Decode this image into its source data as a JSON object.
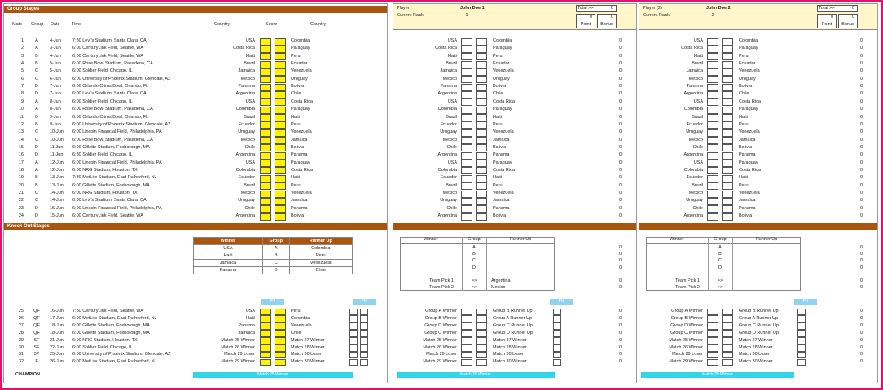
{
  "sections": {
    "group_stages": "Group Stages",
    "knock_out": "Knock Out Stages",
    "champion": "CHAMPION"
  },
  "headers": {
    "match": "Matc",
    "group": "Group",
    "date": "Date",
    "time": "Time",
    "country": "Country",
    "score": "Score"
  },
  "group_matches": [
    {
      "m": "1",
      "g": "A",
      "d": "4-Jun",
      "t": "7:30 Levi's Stadium, Santa Clara, CA",
      "h": "USA",
      "a": "Colombia"
    },
    {
      "m": "2",
      "g": "A",
      "d": "3-Jun",
      "t": "6:00 CenturyLink Field, Seattle, WA",
      "h": "Costa Rica",
      "a": "Paraguay"
    },
    {
      "m": "3",
      "g": "B",
      "d": "4-Jun",
      "t": "6:00 CenturyLink Field, Seattle, WA",
      "h": "Haiti",
      "a": "Peru"
    },
    {
      "m": "4",
      "g": "B",
      "d": "5-Jun",
      "t": "6:00 Rose Bowl Stadium, Pasadena, CA",
      "h": "Brazil",
      "a": "Ecuador"
    },
    {
      "m": "5",
      "g": "C",
      "d": "5-Jun",
      "t": "6:00 Soldier Field, Chicago, IL",
      "h": "Jamaica",
      "a": "Venezuela"
    },
    {
      "m": "6",
      "g": "C",
      "d": "6-Jun",
      "t": "6:00 University of Phoenix Stadium, Glendale, AZ",
      "h": "Mexico",
      "a": "Uruguay"
    },
    {
      "m": "7",
      "g": "D",
      "d": "7-Jun",
      "t": "6:00 Orlando Citrus Bowl, Orlando, FL",
      "h": "Panama",
      "a": "Bolivia"
    },
    {
      "m": "8",
      "g": "D",
      "d": "7-Jun",
      "t": "6:00 Levi's Stadium, Santa Clara, CA",
      "h": "Argentina",
      "a": "Chile"
    },
    {
      "m": "9",
      "g": "A",
      "d": "8-Jun",
      "t": "6:00 Soldier Field, Chicago, IL",
      "h": "USA",
      "a": "Costa Rica"
    },
    {
      "m": "10",
      "g": "A",
      "d": "8-Jun",
      "t": "6:00 Rose Bowl Stadium, Pasadena, CA",
      "h": "Colombia",
      "a": "Paraguay"
    },
    {
      "m": "11",
      "g": "B",
      "d": "9-Jun",
      "t": "6:00 Orlando Citrus Bowl, Orlando, FL",
      "h": "Brazil",
      "a": "Haiti"
    },
    {
      "m": "12",
      "g": "B",
      "d": "9-Jun",
      "t": "6:00 University of Phoenix Stadium, Glendale, AZ",
      "h": "Ecuador",
      "a": "Peru"
    },
    {
      "m": "13",
      "g": "C",
      "d": "10-Jun",
      "t": "6:00 Lincoln Financial Field, Philadelphia, PA",
      "h": "Uruguay",
      "a": "Venezuela"
    },
    {
      "m": "14",
      "g": "C",
      "d": "10-Jun",
      "t": "6:00 Rose Bowl Stadium, Pasadena, CA",
      "h": "Mexico",
      "a": "Jamaica"
    },
    {
      "m": "15",
      "g": "D",
      "d": "11-Jun",
      "t": "6:00 Gillette Stadium, Foxborough, MA",
      "h": "Chile",
      "a": "Bolivia"
    },
    {
      "m": "16",
      "g": "D",
      "d": "11-Jun",
      "t": "6:30 Soldier Field, Chicago, IL",
      "h": "Argentina",
      "a": "Panama"
    },
    {
      "m": "17",
      "g": "A",
      "d": "12-Jun",
      "t": "6:00 Lincoln Financial Field, Philadelphia, PA",
      "h": "USA",
      "a": "Paraguay"
    },
    {
      "m": "18",
      "g": "A",
      "d": "12-Jun",
      "t": "6:00 NRG Stadium, Houston, TX",
      "h": "Colombia",
      "a": "Costa Rica"
    },
    {
      "m": "19",
      "g": "B",
      "d": "13-Jun",
      "t": "7:30 MetLife Stadium, East Rutherford, NJ",
      "h": "Ecuador",
      "a": "Haiti"
    },
    {
      "m": "20",
      "g": "B",
      "d": "13-Jun",
      "t": "6:00 Gillette Stadium, Foxborough, MA",
      "h": "Brazil",
      "a": "Peru"
    },
    {
      "m": "21",
      "g": "C",
      "d": "14-Jun",
      "t": "6:00 NRG Stadium, Houston, TX",
      "h": "Mexico",
      "a": "Venezuela"
    },
    {
      "m": "22",
      "g": "C",
      "d": "14-Jun",
      "t": "6:00 Levi's Stadium, Santa Clara, CA",
      "h": "Uruguay",
      "a": "Jamaica"
    },
    {
      "m": "23",
      "g": "D",
      "d": "15-Jun",
      "t": "6:00 Lincoln Financial Field, Philadelphia, PA",
      "h": "Chile",
      "a": "Panama"
    },
    {
      "m": "24",
      "g": "D",
      "d": "15-Jun",
      "t": "6:00 CenturyLink Field, Seattle, WA",
      "h": "Argentina",
      "a": "Bolivia"
    }
  ],
  "winner_table": {
    "headers": [
      "Winner",
      "Group",
      "Runner Up"
    ],
    "rows": [
      {
        "w": "USA",
        "g": "A",
        "r": "Colombia"
      },
      {
        "w": "Haiti",
        "g": "B",
        "r": "Peru"
      },
      {
        "w": "Jamaica",
        "g": "C",
        "r": "Venezuela"
      },
      {
        "w": "Panama",
        "g": "D",
        "r": "Chile"
      }
    ]
  },
  "ko_labels": {
    "ft": "FT",
    "pk": "PK",
    "final_winner": "Match 25 Winner"
  },
  "ko_matches": [
    {
      "m": "25",
      "g": "QF",
      "d": "16-Jun",
      "t": "7:30 CenturyLink Field, Seattle, WA",
      "h": "USA",
      "a": "Peru"
    },
    {
      "m": "26",
      "g": "QF",
      "d": "17-Jun",
      "t": "6:00 MetLife Stadium, East Rutherford, NJ",
      "h": "Haiti",
      "a": "Colombia"
    },
    {
      "m": "27",
      "g": "QF",
      "d": "18-Jun",
      "t": "6:00 Gillette Stadium, Foxborough, MA",
      "h": "Panama",
      "a": "Venezuela"
    },
    {
      "m": "28",
      "g": "QF",
      "d": "18-Jun",
      "t": "6:00 Gillette Stadium, Foxborough, MA",
      "h": "Jamaica",
      "a": "Chile"
    },
    {
      "m": "29",
      "g": "SF",
      "d": "21-Jun",
      "t": "6:00 NRG Stadium, Houston, TX",
      "h": "Match 25 Winner",
      "a": "Match 27 Winner"
    },
    {
      "m": "30",
      "g": "SF",
      "d": "22-Jun",
      "t": "6:00 Soldier Field, Chicago, IL",
      "h": "Match 26 Winner",
      "a": "Match 28 Winner"
    },
    {
      "m": "31",
      "g": "3P",
      "d": "25-Jun",
      "t": "6:00 University of Phoenix Stadium, Glendale, AZ",
      "h": "Match 29 Loser",
      "a": "Match 30 Loser"
    },
    {
      "m": "32",
      "g": "F",
      "d": "26-Jun",
      "t": "6:00 MetLife Stadium, East Rutherford, NJ",
      "h": "Match 29 Winner",
      "a": "Match 30 Winner"
    }
  ],
  "players": [
    {
      "player_label": "Player",
      "name": "John Doe 1",
      "rank_label": "Current Rank",
      "rank": "1",
      "total_label": "Total >>",
      "total": "0",
      "points_value": "0",
      "bonus_value": "0",
      "point_label": "Point",
      "bonus_label": "Bonus",
      "groups": [
        {
          "h": "USA",
          "a": "Colombia",
          "p": "0"
        },
        {
          "h": "Costa Rica",
          "a": "Paraguay",
          "p": "0"
        },
        {
          "h": "Haiti",
          "a": "Peru",
          "p": "0"
        },
        {
          "h": "Brazil",
          "a": "Ecuador",
          "p": "0"
        },
        {
          "h": "Jamaica",
          "a": "Venezuela",
          "p": "0"
        },
        {
          "h": "Mexico",
          "a": "Uruguay",
          "p": "0"
        },
        {
          "h": "Panama",
          "a": "Bolivia",
          "p": "0"
        },
        {
          "h": "Argentina",
          "a": "Chile",
          "p": "0"
        },
        {
          "h": "USA",
          "a": "Costa Rica",
          "p": "0"
        },
        {
          "h": "Colombia",
          "a": "Paraguay",
          "p": "0"
        },
        {
          "h": "Brazil",
          "a": "Haiti",
          "p": "0"
        },
        {
          "h": "Ecuador",
          "a": "Peru",
          "p": "0"
        },
        {
          "h": "Uruguay",
          "a": "Venezuela",
          "p": "0"
        },
        {
          "h": "Mexico",
          "a": "Jamaica",
          "p": "0"
        },
        {
          "h": "Chile",
          "a": "Bolivia",
          "p": "0"
        },
        {
          "h": "Argentina",
          "a": "Panama",
          "p": "0"
        },
        {
          "h": "USA",
          "a": "Paraguay",
          "p": "0"
        },
        {
          "h": "Colombia",
          "a": "Costa Rica",
          "p": "0"
        },
        {
          "h": "Ecuador",
          "a": "Haiti",
          "p": "0"
        },
        {
          "h": "Brazil",
          "a": "Peru",
          "p": "0"
        },
        {
          "h": "Mexico",
          "a": "Venezuela",
          "p": "0"
        },
        {
          "h": "Uruguay",
          "a": "Jamaica",
          "p": "0"
        },
        {
          "h": "Chile",
          "a": "Panama",
          "p": "0"
        },
        {
          "h": "Argentina",
          "a": "Bolivia",
          "p": "0"
        }
      ],
      "winner_rows": [
        {
          "w": "",
          "g": "A",
          "r": "",
          "p": "0"
        },
        {
          "w": "",
          "g": "B",
          "r": "",
          "p": "0"
        },
        {
          "w": "",
          "g": "C",
          "r": "",
          "p": "0"
        },
        {
          "w": "",
          "g": "D",
          "r": "",
          "p": "0"
        }
      ],
      "team_picks": [
        {
          "label": "Team Pick 1",
          "arrow": ">>",
          "team": "Argentina",
          "p": "0"
        },
        {
          "label": "Team Pick 2",
          "arrow": ">>",
          "team": "Mexico",
          "p": "0"
        }
      ],
      "ko": [
        {
          "h": "Group A Winner",
          "a": "Group B Runner Up",
          "p": "0"
        },
        {
          "h": "Group B Winner",
          "a": "Group A Runner Up",
          "p": "0"
        },
        {
          "h": "Group D Winner",
          "a": "Group C Runner Up",
          "p": "0"
        },
        {
          "h": "Group C Winner",
          "a": "Group D Runner Up",
          "p": "0"
        },
        {
          "h": "Match 25 Winner",
          "a": "Match 27 Winner",
          "p": "0"
        },
        {
          "h": "Match 26 Winner",
          "a": "Match 28 Winner",
          "p": "0"
        },
        {
          "h": "Match 29 Loser",
          "a": "Match 30 Loser",
          "p": "0"
        },
        {
          "h": "Match 29 Winner",
          "a": "Match 30 Winner",
          "p": "0"
        }
      ]
    },
    {
      "player_label": "Player (2)",
      "name": "John Doe 2",
      "rank_label": "Current Rank",
      "rank": "2",
      "total_label": "Total >>",
      "total": "0",
      "points_value": "0",
      "bonus_value": "0",
      "point_label": "Point",
      "bonus_label": "Bonus",
      "groups": [
        {
          "h": "USA",
          "a": "Colombia",
          "p": "0"
        },
        {
          "h": "Costa Rica",
          "a": "Paraguay",
          "p": "0"
        },
        {
          "h": "Haiti",
          "a": "Peru",
          "p": "0"
        },
        {
          "h": "Brazil",
          "a": "Ecuador",
          "p": "0"
        },
        {
          "h": "Jamaica",
          "a": "Venezuela",
          "p": "0"
        },
        {
          "h": "Mexico",
          "a": "Uruguay",
          "p": "0"
        },
        {
          "h": "Panama",
          "a": "Bolivia",
          "p": "0"
        },
        {
          "h": "Argentina",
          "a": "Chile",
          "p": "0"
        },
        {
          "h": "USA",
          "a": "Costa Rica",
          "p": "0"
        },
        {
          "h": "Colombia",
          "a": "Paraguay",
          "p": "0"
        },
        {
          "h": "Brazil",
          "a": "Haiti",
          "p": "0"
        },
        {
          "h": "Ecuador",
          "a": "Peru",
          "p": "0"
        },
        {
          "h": "Uruguay",
          "a": "Venezuela",
          "p": "0"
        },
        {
          "h": "Mexico",
          "a": "Jamaica",
          "p": "0"
        },
        {
          "h": "Chile",
          "a": "Bolivia",
          "p": "0"
        },
        {
          "h": "Argentina",
          "a": "Panama",
          "p": "0"
        },
        {
          "h": "USA",
          "a": "Paraguay",
          "p": "0"
        },
        {
          "h": "Colombia",
          "a": "Costa Rica",
          "p": "0"
        },
        {
          "h": "Ecuador",
          "a": "Haiti",
          "p": "0"
        },
        {
          "h": "Brazil",
          "a": "Peru",
          "p": "0"
        },
        {
          "h": "Mexico",
          "a": "Venezuela",
          "p": "0"
        },
        {
          "h": "Uruguay",
          "a": "Jamaica",
          "p": "0"
        },
        {
          "h": "Chile",
          "a": "Panama",
          "p": "0"
        },
        {
          "h": "Argentina",
          "a": "Bolivia",
          "p": "0"
        }
      ],
      "winner_rows": [
        {
          "w": "",
          "g": "A",
          "r": "",
          "p": "0"
        },
        {
          "w": "",
          "g": "B",
          "r": "",
          "p": "0"
        },
        {
          "w": "",
          "g": "C",
          "r": "",
          "p": "0"
        },
        {
          "w": "",
          "g": "D",
          "r": "",
          "p": "0"
        }
      ],
      "team_picks": [
        {
          "label": "Team Pick 1",
          "arrow": ">>",
          "team": "",
          "p": "0"
        },
        {
          "label": "Team Pick 2",
          "arrow": ">>",
          "team": "",
          "p": "0"
        }
      ],
      "ko": [
        {
          "h": "Group A Winner",
          "a": "Group B Runner Up",
          "p": "0"
        },
        {
          "h": "Group B Winner",
          "a": "Group A Runner Up",
          "p": "0"
        },
        {
          "h": "Group D Winner",
          "a": "Group C Runner Up",
          "p": "0"
        },
        {
          "h": "Group C Winner",
          "a": "Group D Runner Up",
          "p": "0"
        },
        {
          "h": "Match 25 Winner",
          "a": "Match 27 Winner",
          "p": "0"
        },
        {
          "h": "Match 26 Winner",
          "a": "Match 28 Winner",
          "p": "0"
        },
        {
          "h": "Match 29 Loser",
          "a": "Match 30 Loser",
          "p": "0"
        },
        {
          "h": "Match 29 Winner",
          "a": "Match 30 Winner",
          "p": "0"
        }
      ]
    }
  ],
  "panel2_common": {
    "winner": "Winner",
    "group": "Group",
    "runner_up": "Runner Up",
    "pk": "PK",
    "final_winner": "Match 29 Winner"
  }
}
